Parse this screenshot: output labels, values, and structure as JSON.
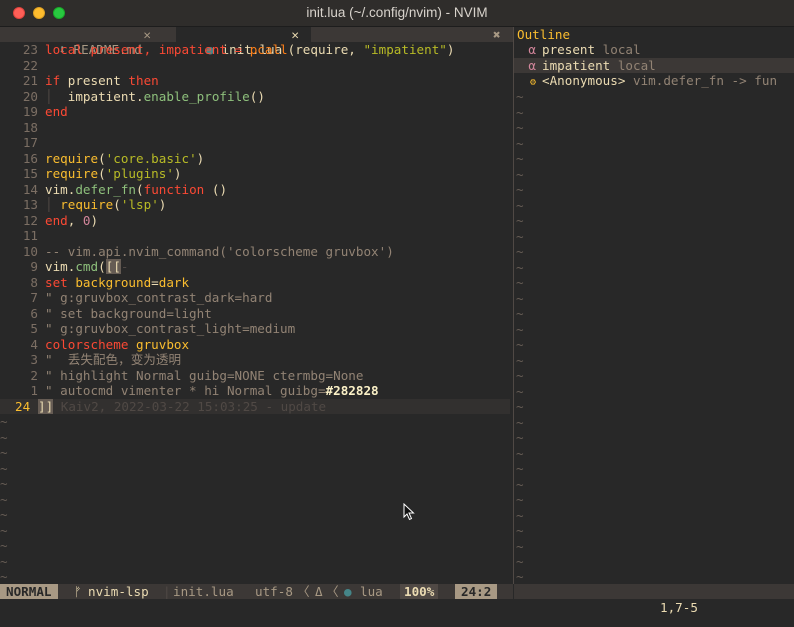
{
  "window": {
    "title": "init.lua (~/.config/nvim) - NVIM"
  },
  "tabs": [
    {
      "icon": "⬇",
      "label": "README.md",
      "close": "✕"
    },
    {
      "icon": "●",
      "label": "init.lua",
      "close": "✕"
    }
  ],
  "tab_close_all": "✖",
  "editor": {
    "lines": [
      {
        "num": "23"
      },
      {
        "num": "22"
      },
      {
        "num": "21"
      },
      {
        "num": "20"
      },
      {
        "num": "19"
      },
      {
        "num": "18"
      },
      {
        "num": "17"
      },
      {
        "num": "16"
      },
      {
        "num": "15"
      },
      {
        "num": "14"
      },
      {
        "num": "13"
      },
      {
        "num": "12"
      },
      {
        "num": "11"
      },
      {
        "num": "10"
      },
      {
        "num": "9"
      },
      {
        "num": "8"
      },
      {
        "num": "7"
      },
      {
        "num": "6"
      },
      {
        "num": "5"
      },
      {
        "num": "4"
      },
      {
        "num": "3"
      },
      {
        "num": "2"
      },
      {
        "num": "1"
      },
      {
        "num": "24"
      }
    ],
    "code": {
      "l23_a": "local present, impatient = ",
      "l23_fn": "pcall",
      "l23_b": "(require, ",
      "l23_str": "\"impatient\"",
      "l23_c": ")",
      "l21_if": "if",
      "l21_present": " present ",
      "l21_then": "then",
      "l20_obj": "impatient.",
      "l20_fn": "enable_profile",
      "l20_paren": "()",
      "l19_end": "end",
      "l16_fn": "require",
      "l16_str": "'core.basic'",
      "l15_fn": "require",
      "l15_str": "'plugins'",
      "l14_obj": "vim.",
      "l14_fn": "defer_fn",
      "l14_kw": "function",
      "l14_rest": " ()",
      "l13_fn": "require",
      "l13_str": "'lsp'",
      "l12_end": "end",
      "l12_comma": ", ",
      "l12_num": "0",
      "l12_close": ")",
      "l10_comment": "-- vim.api.nvim_command('colorscheme gruvbox')",
      "l9_obj": "vim.",
      "l9_fn": "cmd",
      "l9_br": "[[",
      "l9_dash": "-",
      "l8_set": "set",
      "l8_opt": " background",
      "l8_eq": "=",
      "l8_val": "dark",
      "l7": "\" g:gruvbox_contrast_dark=hard",
      "l6": "\" set background=light",
      "l5": "\" g:gruvbox_contrast_light=medium",
      "l4_cs": "colorscheme",
      "l4_name": " gruvbox",
      "l3": "\"  丢失配色，变为透明",
      "l2": "\" highlight Normal guibg=NONE ctermbg=None",
      "l1_a": "\" autocmd vimenter * hi Normal guibg=",
      "l1_b": "#282828",
      "l24_br": "]]",
      "l24_blame": " Kaiv2, 2022-03-22 15:03:25 - update"
    },
    "tilde": "~"
  },
  "outline": {
    "title": "Outline",
    "items": [
      {
        "symbol": "α",
        "name": "present",
        "detail": " local"
      },
      {
        "symbol": "α",
        "name": "impatient",
        "detail": " local"
      },
      {
        "symbol": "⚙",
        "name": "<Anonymous>",
        "detail": " vim.defer_fn -> fun"
      }
    ]
  },
  "statusline": {
    "mode": "NORMAL",
    "branch_icon": "ᚠ",
    "branch": "nvim-lsp",
    "file": "init.lua",
    "encoding": "utf-8",
    "sep1": "〈",
    "delta": "Δ",
    "sep2": "〈",
    "ft_icon": "●",
    "filetype": "lua",
    "percent": "100%",
    "position": "24:2"
  },
  "cmdline": {
    "ruler": "1,7-5"
  }
}
